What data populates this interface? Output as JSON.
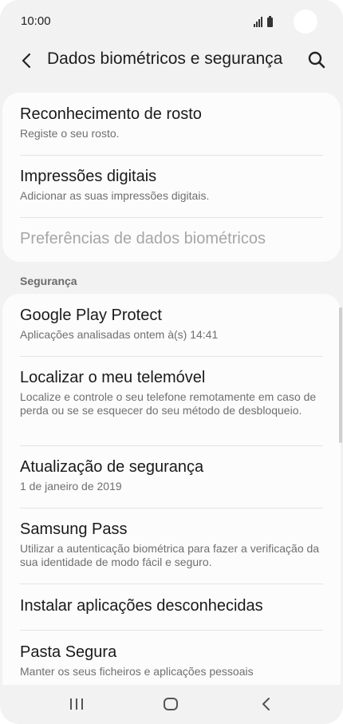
{
  "status_bar": {
    "time": "10:00",
    "icons": [
      "signal-icon",
      "battery-icon"
    ]
  },
  "header": {
    "back_icon": "chevron-left-icon",
    "title": "Dados biométricos e segurança",
    "search_icon": "search-icon"
  },
  "biometrics": {
    "items": [
      {
        "title": "Reconhecimento de rosto",
        "subtitle": "Registe o seu rosto."
      },
      {
        "title": "Impressões digitais",
        "subtitle": "Adicionar as suas impressões digitais."
      },
      {
        "title": "Preferências de dados biométricos",
        "subtitle": ""
      }
    ]
  },
  "security": {
    "label": "Segurança",
    "items": [
      {
        "title": "Google Play Protect",
        "subtitle": "Aplicações analisadas ontem à(s) 14:41"
      },
      {
        "title": "Localizar o meu telemóvel",
        "subtitle": "Localize e controle o seu telefone remotamente em caso de perda ou se se esquecer do seu método de desbloqueio."
      },
      {
        "title": "Atualização de segurança",
        "subtitle": "1 de janeiro de 2019"
      },
      {
        "title": "Samsung Pass",
        "subtitle": "Utilizar a autenticação biométrica para fazer a verificação da sua identidade de modo fácil e seguro."
      },
      {
        "title": "Instalar aplicações desconhecidas",
        "subtitle": ""
      },
      {
        "title": "Pasta Segura",
        "subtitle": "Manter os seus ficheiros e aplicações pessoais"
      }
    ]
  },
  "nav": {
    "icons": [
      "recent-apps-icon",
      "home-icon",
      "back-icon"
    ]
  }
}
